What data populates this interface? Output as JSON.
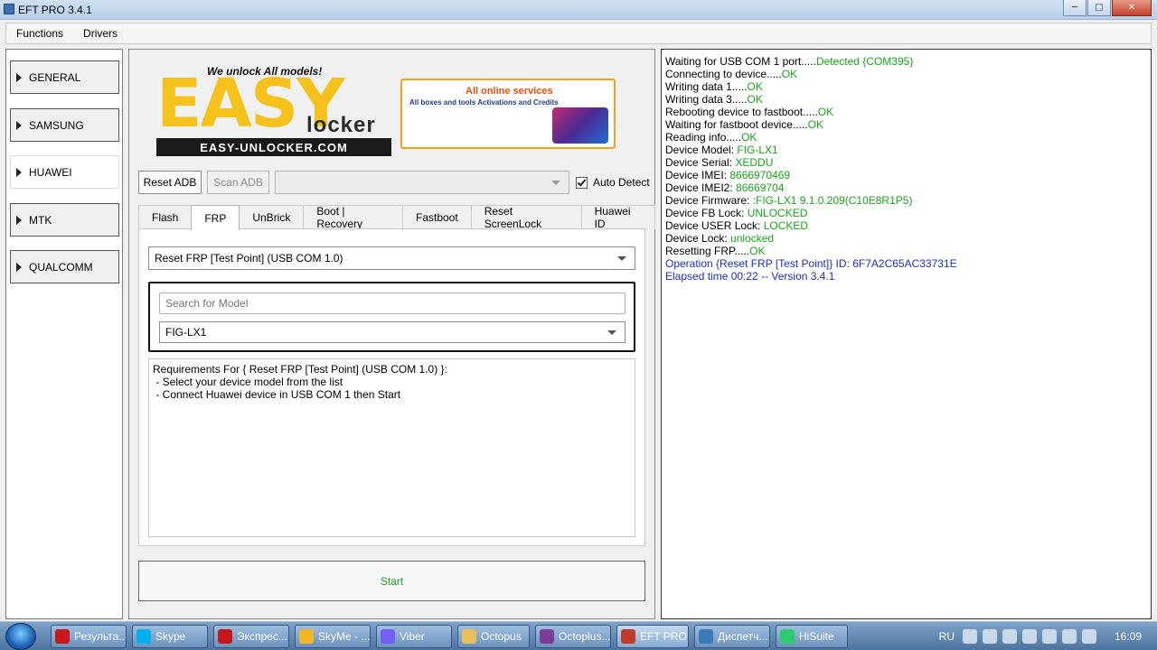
{
  "window": {
    "title": "EFT PRO 3.4.1"
  },
  "menu": [
    "Functions",
    "Drivers"
  ],
  "categories": [
    "GENERAL",
    "SAMSUNG",
    "HUAWEI",
    "MTK",
    "QUALCOMM"
  ],
  "banner": {
    "logo_text": "EASY",
    "tagline": "We unlock All models!",
    "locker_text": "locker",
    "site": "EASY-UNLOCKER.COM",
    "promo_title": "All online services",
    "promo_sub": "All boxes and tools Activations and Credits"
  },
  "adb": {
    "reset_label": "Reset ADB",
    "scan_label": "Scan ADB",
    "port_value": "",
    "auto_detect_label": "Auto Detect",
    "auto_detect_checked": true
  },
  "tabs": [
    "Flash",
    "FRP",
    "UnBrick",
    "Boot | Recovery",
    "Fastboot",
    "Reset ScreenLock",
    "Huawei ID"
  ],
  "active_tab": "FRP",
  "frp": {
    "operation": "Reset FRP [Test Point] (USB COM 1.0)",
    "search_placeholder": "Search for Model",
    "model": "FIG-LX1",
    "requirements": "Requirements For { Reset FRP [Test Point] (USB COM 1.0) }:\n - Select your device model from the list\n - Connect Huawei device in USB COM 1 then Start"
  },
  "start_label": "Start",
  "log": [
    {
      "text": "Waiting for USB COM 1 port.....",
      "value": "Detected {COM395}"
    },
    {
      "text": "Connecting to device.....",
      "value": "OK"
    },
    {
      "text": "Writing data 1.....",
      "value": "OK"
    },
    {
      "text": "Writing data 3.....",
      "value": "OK"
    },
    {
      "text": "Rebooting device to fastboot.....",
      "value": "OK"
    },
    {
      "text": "Waiting for fastboot device.....",
      "value": "OK"
    },
    {
      "text": "Reading info.....",
      "value": "OK"
    },
    {
      "text": "Device Model: ",
      "value": "FIG-LX1"
    },
    {
      "text": "Device Serial: ",
      "value": "XEDDU"
    },
    {
      "text": "Device IMEI: ",
      "value": "8666970469"
    },
    {
      "text": "Device IMEI2: ",
      "value": "86669704"
    },
    {
      "text": "Device Firmware: ",
      "value": ":FIG-LX1 9.1.0.209(C10E8R1P5)"
    },
    {
      "text": "Device FB Lock: ",
      "value": "UNLOCKED"
    },
    {
      "text": "Device USER Lock: ",
      "value": "LOCKED"
    },
    {
      "text": "Device Lock: ",
      "value": "unlocked"
    },
    {
      "text": "Resetting FRP.....",
      "value": "OK"
    },
    {
      "text": "",
      "value": "",
      "blue": "Operation {Reset FRP [Test Point]} ID: 6F7A2C65AC33731E"
    },
    {
      "text": "",
      "value": "",
      "blue": "Elapsed time 00:22 -- Version 3.4.1"
    }
  ],
  "taskbar": {
    "items": [
      {
        "label": "Результа...",
        "icon_color": "#c8161d"
      },
      {
        "label": "Skype",
        "icon_color": "#00aff0"
      },
      {
        "label": "Экспрес...",
        "icon_color": "#c8161d"
      },
      {
        "label": "SkyMe - ...",
        "icon_color": "#f2b824"
      },
      {
        "label": "Viber",
        "icon_color": "#7360f2"
      },
      {
        "label": "Octopus",
        "icon_color": "#e8c05a"
      },
      {
        "label": "Octoplus...",
        "icon_color": "#7d3c98"
      },
      {
        "label": "EFT PRO ...",
        "icon_color": "#c0392b"
      },
      {
        "label": "Диспетч...",
        "icon_color": "#3d7ab8"
      },
      {
        "label": "HiSuite",
        "icon_color": "#2ecc71"
      }
    ],
    "lang": "RU",
    "clock": "16:09"
  }
}
